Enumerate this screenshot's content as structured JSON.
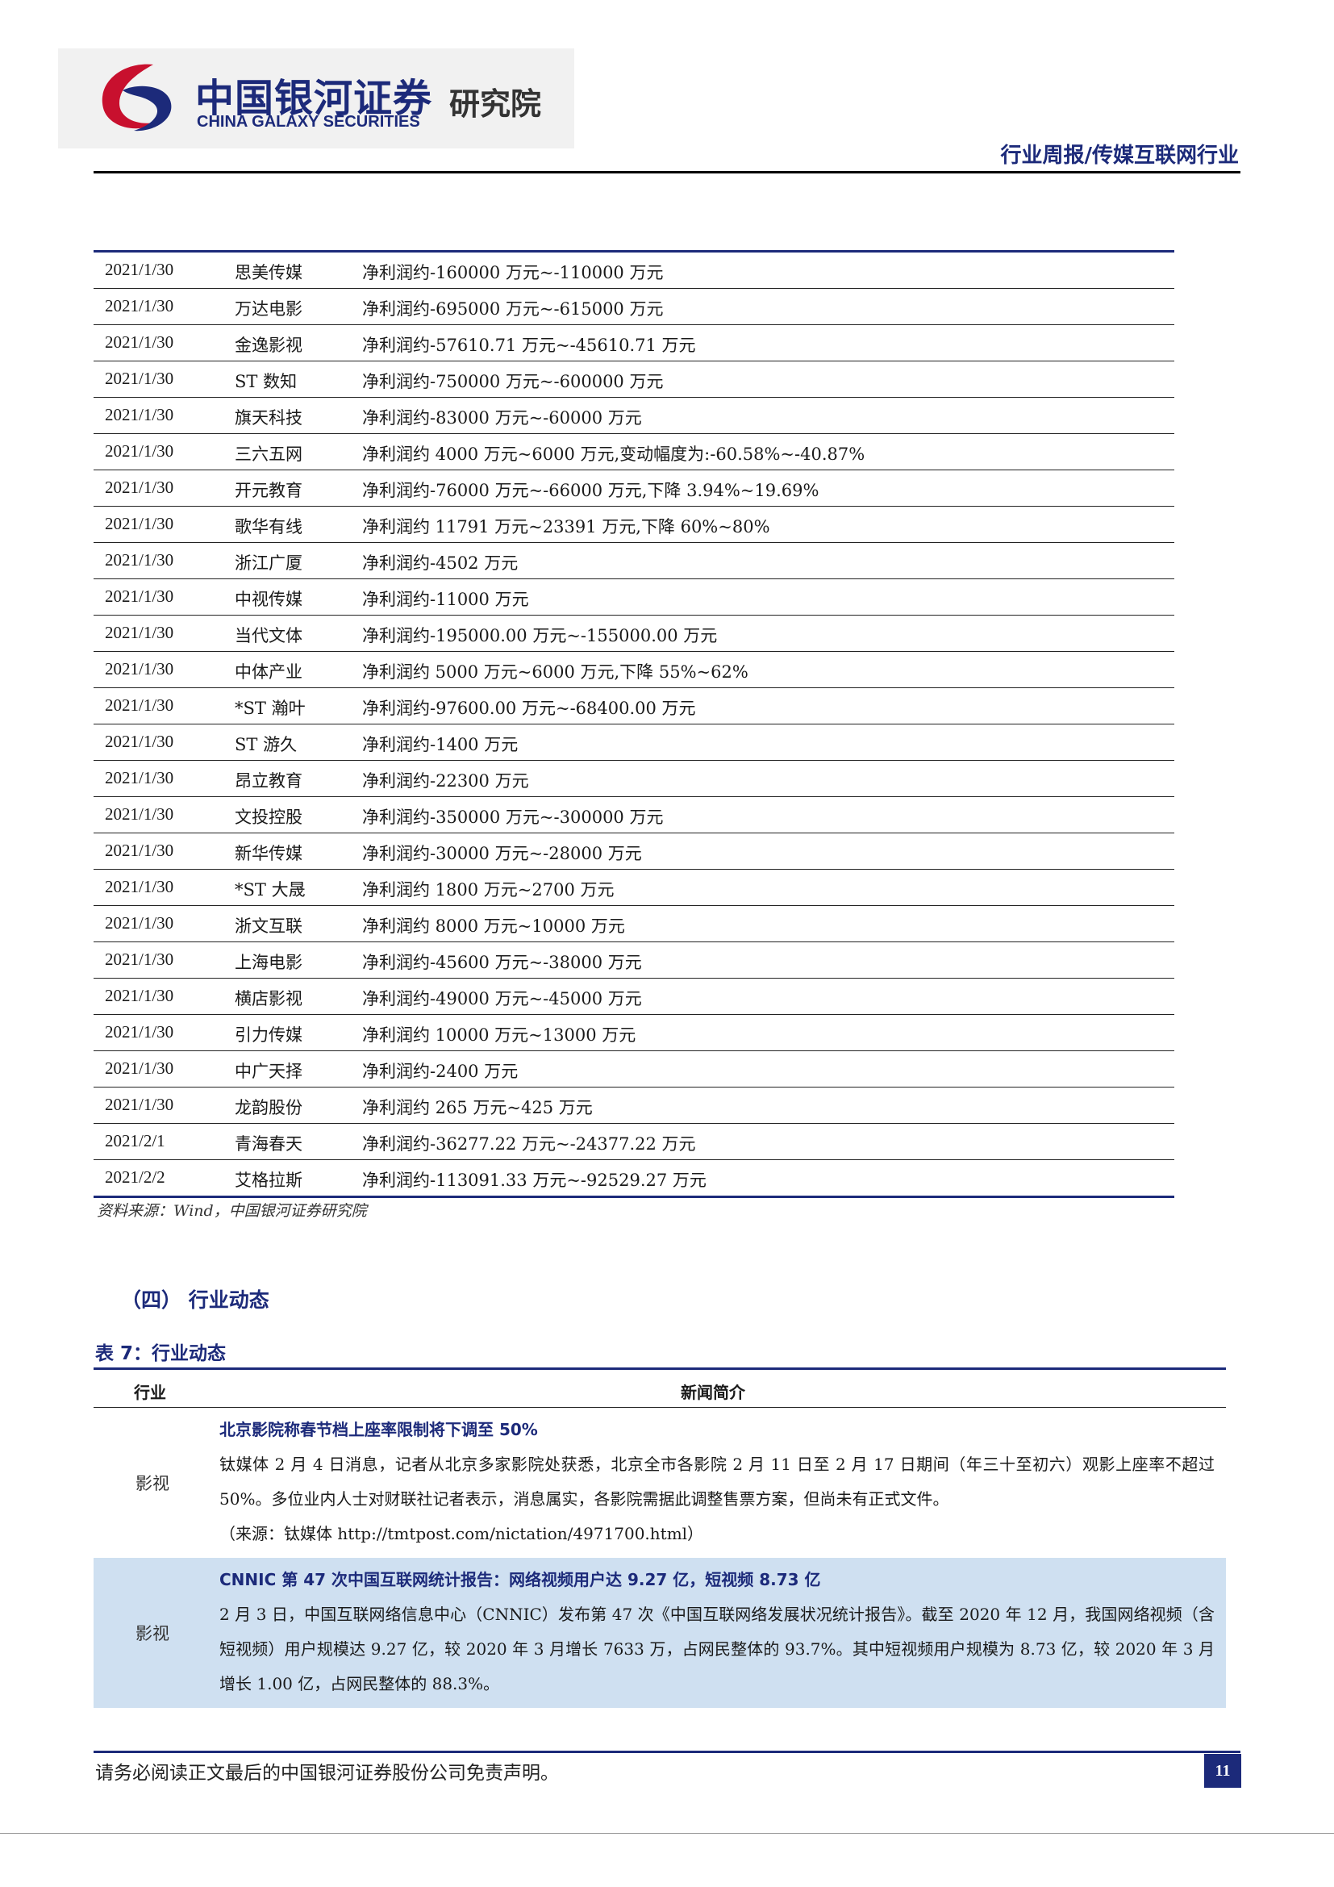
{
  "header": {
    "logo_cn": "中国银河证券",
    "logo_en": "CHINA GALAXY SECURITIES",
    "logo_inst": "研究院",
    "report_type": "行业周报/传媒互联网行业"
  },
  "forecast_table": {
    "rows": [
      {
        "date": "2021/1/30",
        "company": "思美传媒",
        "note": "净利润约-160000 万元~-110000 万元"
      },
      {
        "date": "2021/1/30",
        "company": "万达电影",
        "note": "净利润约-695000 万元~-615000 万元"
      },
      {
        "date": "2021/1/30",
        "company": "金逸影视",
        "note": "净利润约-57610.71 万元~-45610.71 万元"
      },
      {
        "date": "2021/1/30",
        "company": "ST 数知",
        "note": "净利润约-750000 万元~-600000 万元"
      },
      {
        "date": "2021/1/30",
        "company": "旗天科技",
        "note": "净利润约-83000 万元~-60000 万元"
      },
      {
        "date": "2021/1/30",
        "company": "三六五网",
        "note": "净利润约 4000 万元~6000 万元,变动幅度为:-60.58%~-40.87%"
      },
      {
        "date": "2021/1/30",
        "company": "开元教育",
        "note": "净利润约-76000 万元~-66000 万元,下降 3.94%~19.69%"
      },
      {
        "date": "2021/1/30",
        "company": "歌华有线",
        "note": "净利润约 11791 万元~23391 万元,下降 60%~80%"
      },
      {
        "date": "2021/1/30",
        "company": "浙江广厦",
        "note": "净利润约-4502 万元"
      },
      {
        "date": "2021/1/30",
        "company": "中视传媒",
        "note": "净利润约-11000 万元"
      },
      {
        "date": "2021/1/30",
        "company": "当代文体",
        "note": "净利润约-195000.00 万元~-155000.00 万元"
      },
      {
        "date": "2021/1/30",
        "company": "中体产业",
        "note": "净利润约 5000 万元~6000 万元,下降 55%~62%"
      },
      {
        "date": "2021/1/30",
        "company": "*ST 瀚叶",
        "note": "净利润约-97600.00 万元~-68400.00 万元"
      },
      {
        "date": "2021/1/30",
        "company": "ST 游久",
        "note": "净利润约-1400 万元"
      },
      {
        "date": "2021/1/30",
        "company": "昂立教育",
        "note": "净利润约-22300 万元"
      },
      {
        "date": "2021/1/30",
        "company": "文投控股",
        "note": "净利润约-350000 万元~-300000 万元"
      },
      {
        "date": "2021/1/30",
        "company": "新华传媒",
        "note": "净利润约-30000 万元~-28000 万元"
      },
      {
        "date": "2021/1/30",
        "company": "*ST 大晟",
        "note": "净利润约 1800 万元~2700 万元"
      },
      {
        "date": "2021/1/30",
        "company": "浙文互联",
        "note": "净利润约 8000 万元~10000 万元"
      },
      {
        "date": "2021/1/30",
        "company": "上海电影",
        "note": "净利润约-45600 万元~-38000 万元"
      },
      {
        "date": "2021/1/30",
        "company": "横店影视",
        "note": "净利润约-49000 万元~-45000 万元"
      },
      {
        "date": "2021/1/30",
        "company": "引力传媒",
        "note": "净利润约 10000 万元~13000 万元"
      },
      {
        "date": "2021/1/30",
        "company": "中广天择",
        "note": "净利润约-2400 万元"
      },
      {
        "date": "2021/1/30",
        "company": "龙韵股份",
        "note": "净利润约 265 万元~425 万元"
      },
      {
        "date": "2021/2/1",
        "company": "青海春天",
        "note": "净利润约-36277.22 万元~-24377.22 万元"
      },
      {
        "date": "2021/2/2",
        "company": "艾格拉斯",
        "note": "净利润约-113091.33 万元~-92529.27 万元"
      }
    ],
    "source": "资料来源：Wind，中国银河证券研究院"
  },
  "section": {
    "heading": "（四）  行业动态",
    "table_caption": "表 7：行业动态"
  },
  "news_table": {
    "col_industry": "行业",
    "col_news": "新闻简介",
    "rows": [
      {
        "industry": "影视",
        "title": "北京影院称春节档上座率限制将下调至 50%",
        "body": "钛媒体 2 月 4 日消息，记者从北京多家影院处获悉，北京全市各影院 2 月 11 日至 2 月 17 日期间（年三十至初六）观影上座率不超过 50%。多位业内人士对财联社记者表示，消息属实，各影院需据此调整售票方案，但尚未有正式文件。",
        "source": "（来源：钛媒体 http://tmtpost.com/nictation/4971700.html）"
      },
      {
        "industry": "影视",
        "title": "CNNIC 第 47 次中国互联网统计报告：网络视频用户达 9.27 亿，短视频 8.73 亿",
        "body": "2 月 3 日，中国互联网络信息中心（CNNIC）发布第 47 次《中国互联网络发展状况统计报告》。截至 2020 年 12 月，我国网络视频（含短视频）用户规模达 9.27 亿，较 2020 年 3 月增长 7633 万，占网民整体的 93.7%。其中短视频用户规模为 8.73 亿，较 2020 年 3 月增长 1.00 亿，占网民整体的 88.3%。",
        "source": ""
      }
    ]
  },
  "footer": {
    "disclaimer": "请务必阅读正文最后的中国银河证券股份公司免责声明。",
    "page": "11"
  },
  "colors": {
    "brand_navy": "#1c2a7a",
    "brand_red": "#c8102e",
    "shade_blue": "#cfe0f1"
  }
}
